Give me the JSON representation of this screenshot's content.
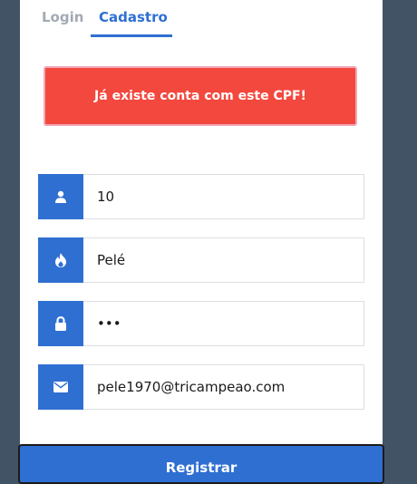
{
  "tabs": {
    "login_label": "Login",
    "register_label": "Cadastro"
  },
  "alert": {
    "message": "Já existe conta com este CPF!"
  },
  "form": {
    "cpf_value": "10",
    "name_value": "Pelé",
    "password_mask": "•••",
    "email_value": "pele1970@tricampeao.com",
    "submit_label": "Registrar"
  },
  "icons": {
    "cpf": "user-icon",
    "name": "fire-icon",
    "password": "lock-icon",
    "email": "envelope-icon"
  },
  "colors": {
    "background": "#435366",
    "accent": "#2f6fd2",
    "alert": "#f3483e",
    "inactive_tab": "#a3a9b3"
  }
}
